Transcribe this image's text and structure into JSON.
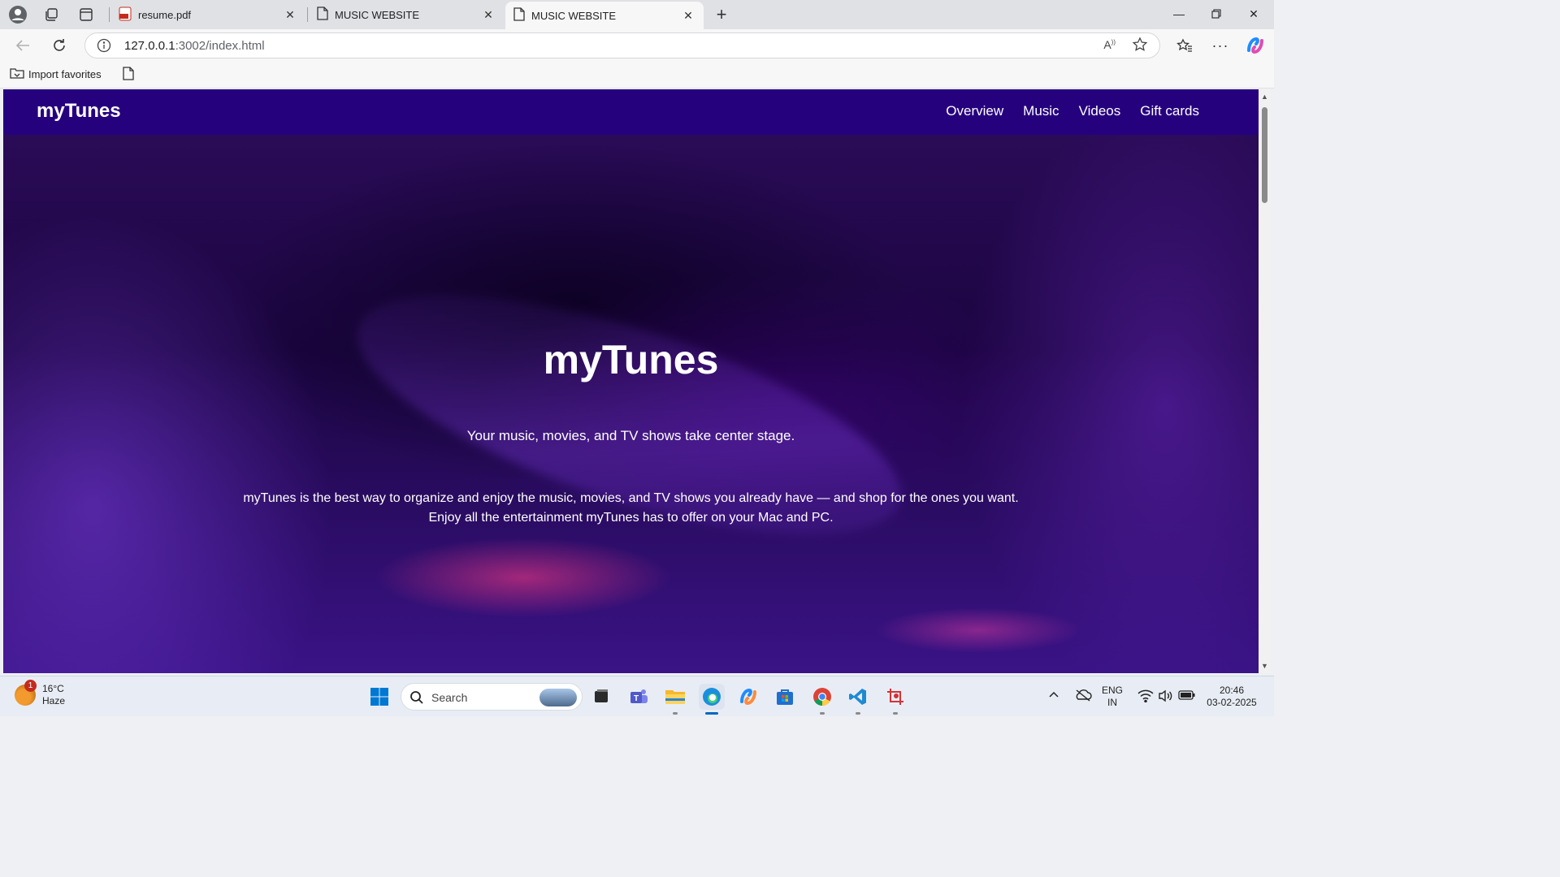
{
  "browser": {
    "tabs": [
      {
        "title": "resume.pdf",
        "icon": "pdf-icon"
      },
      {
        "title": "MUSIC WEBSITE",
        "icon": "page-icon"
      },
      {
        "title": "MUSIC WEBSITE",
        "icon": "page-icon",
        "active": true
      }
    ],
    "address": {
      "host": "127.0.0.1",
      "rest": ":3002/index.html"
    },
    "favorites": {
      "import_label": "Import favorites"
    }
  },
  "site": {
    "brand": "myTunes",
    "nav": [
      "Overview",
      "Music",
      "Videos",
      "Gift cards"
    ],
    "hero": {
      "title": "myTunes",
      "subtitle": "Your music, movies, and TV shows take center stage.",
      "desc_line1": "myTunes is the best way to organize and enjoy the music, movies, and TV shows you already have — and shop for the ones you want.",
      "desc_line2": "Enjoy all the entertainment myTunes has to offer on your Mac and PC."
    },
    "colors": {
      "nav_bg": "#26017e",
      "hero_tint": "#2a0b57"
    }
  },
  "taskbar": {
    "weather": {
      "temp": "16°C",
      "condition": "Haze",
      "badge": "1"
    },
    "search_placeholder": "Search",
    "tray": {
      "lang_top": "ENG",
      "lang_bottom": "IN",
      "time": "20:46",
      "date": "03-02-2025"
    }
  }
}
